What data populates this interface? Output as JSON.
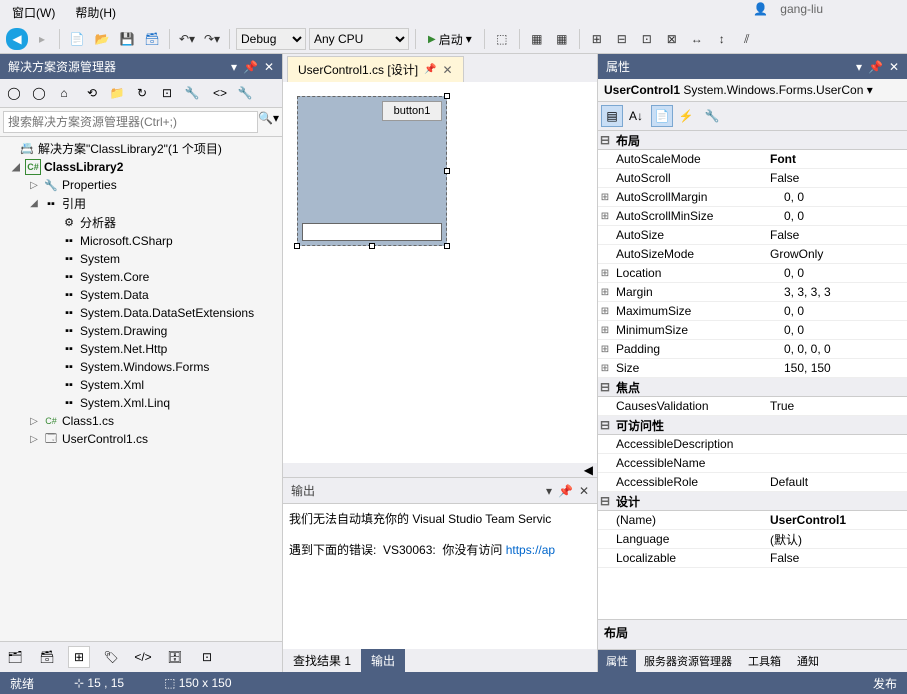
{
  "menu": {
    "window": "窗口(W)",
    "help": "帮助(H)"
  },
  "user": "gang-liu",
  "toolbar": {
    "config": "Debug",
    "platform": "Any CPU",
    "start": "启动"
  },
  "solution_explorer": {
    "title": "解决方案资源管理器",
    "search_placeholder": "搜索解决方案资源管理器(Ctrl+;)",
    "root": "解决方案\"ClassLibrary2\"(1 个项目)",
    "project": "ClassLibrary2",
    "properties": "Properties",
    "references": "引用",
    "analyzers": "分析器",
    "refs": [
      "Microsoft.CSharp",
      "System",
      "System.Core",
      "System.Data",
      "System.Data.DataSetExtensions",
      "System.Drawing",
      "System.Net.Http",
      "System.Windows.Forms",
      "System.Xml",
      "System.Xml.Linq"
    ],
    "files": [
      "Class1.cs",
      "UserControl1.cs"
    ]
  },
  "editor": {
    "tab": "UserControl1.cs [设计]",
    "button_text": "button1"
  },
  "output": {
    "title": "输出",
    "line1": "我们无法自动填充你的 Visual Studio Team Servic",
    "line2a": "遇到下面的错误:  VS30063:  你没有访问 ",
    "line2b": "https://ap",
    "tabs": {
      "find": "查找结果 1",
      "out": "输出"
    }
  },
  "properties": {
    "title": "属性",
    "header_name": "UserControl1",
    "header_type": "System.Windows.Forms.UserCon",
    "cats": {
      "layout": "布局",
      "focus": "焦点",
      "access": "可访问性",
      "design": "设计"
    },
    "rows": [
      {
        "e": "",
        "n": "AutoScaleMode",
        "v": "Font",
        "b": true
      },
      {
        "e": "",
        "n": "AutoScroll",
        "v": "False"
      },
      {
        "e": "⊞",
        "n": "AutoScrollMargin",
        "v": "0, 0"
      },
      {
        "e": "⊞",
        "n": "AutoScrollMinSize",
        "v": "0, 0"
      },
      {
        "e": "",
        "n": "AutoSize",
        "v": "False"
      },
      {
        "e": "",
        "n": "AutoSizeMode",
        "v": "GrowOnly"
      },
      {
        "e": "⊞",
        "n": "Location",
        "v": "0, 0"
      },
      {
        "e": "⊞",
        "n": "Margin",
        "v": "3, 3, 3, 3"
      },
      {
        "e": "⊞",
        "n": "MaximumSize",
        "v": "0, 0"
      },
      {
        "e": "⊞",
        "n": "MinimumSize",
        "v": "0, 0"
      },
      {
        "e": "⊞",
        "n": "Padding",
        "v": "0, 0, 0, 0"
      },
      {
        "e": "⊞",
        "n": "Size",
        "v": "150, 150"
      }
    ],
    "focus_rows": [
      {
        "e": "",
        "n": "CausesValidation",
        "v": "True"
      }
    ],
    "access_rows": [
      {
        "e": "",
        "n": "AccessibleDescription",
        "v": ""
      },
      {
        "e": "",
        "n": "AccessibleName",
        "v": ""
      },
      {
        "e": "",
        "n": "AccessibleRole",
        "v": "Default"
      }
    ],
    "design_rows": [
      {
        "e": "",
        "n": "(Name)",
        "v": "UserControl1",
        "b": true
      },
      {
        "e": "",
        "n": "Language",
        "v": "(默认)"
      },
      {
        "e": "",
        "n": "Localizable",
        "v": "False"
      }
    ],
    "desc": "布局",
    "tabs": {
      "prop": "属性",
      "srv": "服务器资源管理器",
      "tool": "工具箱",
      "notif": "通知"
    }
  },
  "status": {
    "ready": "就绪",
    "pos": "15 , 15",
    "size": "150 x 150",
    "pub": "发布"
  }
}
